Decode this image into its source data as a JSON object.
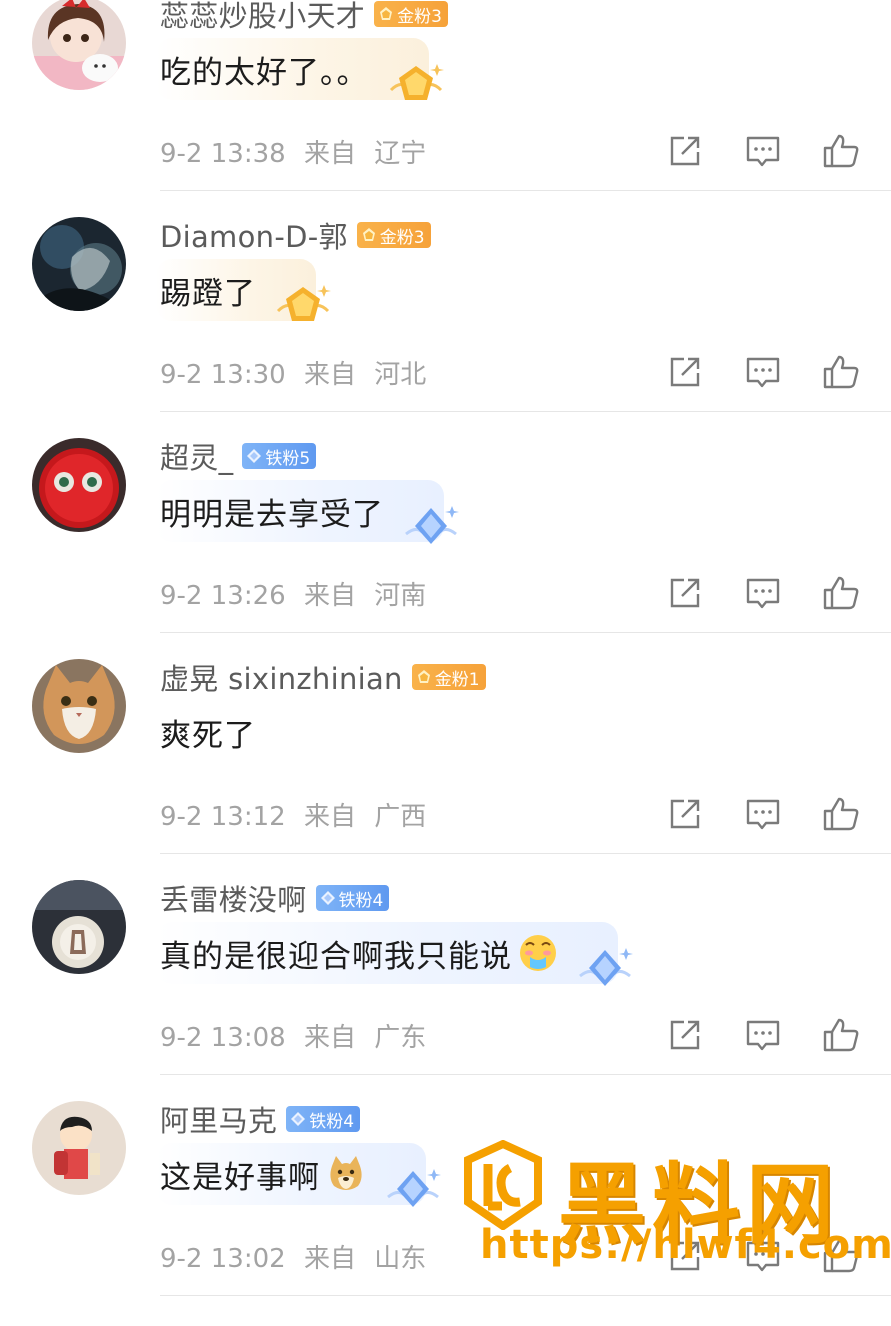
{
  "comments": [
    {
      "username": "蕊蕊炒股小天才",
      "badge": "金粉3",
      "badge_type": "gold",
      "text": "吃的太好了。。",
      "time": "9-2 13:38",
      "from_label": "来自",
      "location": "辽宁",
      "avatar": "anime-girl-with-cat"
    },
    {
      "username": "Diamon-D-郭",
      "badge": "金粉3",
      "badge_type": "gold",
      "text": "踢蹬了",
      "time": "9-2 13:30",
      "from_label": "来自",
      "location": "河北",
      "avatar": "dark-character-portrait"
    },
    {
      "username": "超灵_",
      "badge": "铁粉5",
      "badge_type": "iron",
      "text": "明明是去享受了",
      "time": "9-2 13:26",
      "from_label": "来自",
      "location": "河南",
      "avatar": "red-fuzzy-monster"
    },
    {
      "username": "虚晃 sixinzhinian",
      "badge": "金粉1",
      "badge_type": "gold",
      "text": "爽死了",
      "time": "9-2 13:12",
      "from_label": "来自",
      "location": "广西",
      "avatar": "orange-cat"
    },
    {
      "username": "丢雷楼没啊",
      "badge": "铁粉4",
      "badge_type": "iron",
      "text": "真的是很迎合啊我只能说",
      "emoji": "drooling-face",
      "time": "9-2 13:08",
      "from_label": "来自",
      "location": "广东",
      "avatar": "car-logo"
    },
    {
      "username": "阿里马克",
      "badge": "铁粉4",
      "badge_type": "iron",
      "text": "这是好事啊",
      "emoji": "doge",
      "time": "9-2 13:02",
      "from_label": "来自",
      "location": "山东",
      "avatar": "crayon-shin-chan"
    }
  ],
  "colors": {
    "gold_badge": "#f6a23a",
    "iron_badge": "#5f99f0",
    "meta_text": "#a3a3a3",
    "username": "#5b5b5b",
    "watermark": "#f5a000"
  },
  "watermark": {
    "title": "黑料网",
    "url": "https://hlwf4.com"
  }
}
